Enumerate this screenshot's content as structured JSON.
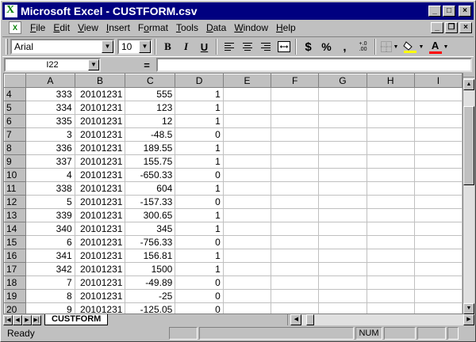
{
  "window": {
    "title": "Microsoft Excel - CUSTFORM.csv",
    "app_icon_glyph": "X",
    "minimize_glyph": "_",
    "maximize_glyph": "□",
    "close_glyph": "×"
  },
  "menu": {
    "items": [
      {
        "label": "File",
        "accel": "F",
        "rest": "ile"
      },
      {
        "label": "Edit",
        "accel": "E",
        "rest": "dit"
      },
      {
        "label": "View",
        "accel": "V",
        "rest": "iew"
      },
      {
        "label": "Insert",
        "accel": "I",
        "rest": "nsert"
      },
      {
        "label": "Format",
        "accel": "o",
        "pre": "F",
        "rest": "rmat"
      },
      {
        "label": "Tools",
        "accel": "T",
        "rest": "ools"
      },
      {
        "label": "Data",
        "accel": "D",
        "rest": "ata"
      },
      {
        "label": "Window",
        "accel": "W",
        "rest": "indow"
      },
      {
        "label": "Help",
        "accel": "H",
        "rest": "elp"
      }
    ],
    "doc_minimize_glyph": "_",
    "doc_restore_glyph": "❐",
    "doc_close_glyph": "×"
  },
  "toolbar": {
    "font_name": "Arial",
    "font_size": "10",
    "bold": "B",
    "italic": "I",
    "underline": "U",
    "currency": "$",
    "percent": "%",
    "comma": ",",
    "increase_decimal": "+.0\n.00",
    "font_color_letter": "A",
    "accent_red": "#ff0000",
    "accent_yellow": "#ffff00"
  },
  "formula_bar": {
    "name_box": "I22",
    "equals": "=",
    "formula": ""
  },
  "grid": {
    "columns": [
      "A",
      "B",
      "C",
      "D",
      "E",
      "F",
      "G",
      "H",
      "I"
    ],
    "rows": [
      {
        "n": "4",
        "a": "333",
        "b": "20101231",
        "c": "555",
        "d": "1"
      },
      {
        "n": "5",
        "a": "334",
        "b": "20101231",
        "c": "123",
        "d": "1"
      },
      {
        "n": "6",
        "a": "335",
        "b": "20101231",
        "c": "12",
        "d": "1"
      },
      {
        "n": "7",
        "a": "3",
        "b": "20101231",
        "c": "-48.5",
        "d": "0"
      },
      {
        "n": "8",
        "a": "336",
        "b": "20101231",
        "c": "189.55",
        "d": "1"
      },
      {
        "n": "9",
        "a": "337",
        "b": "20101231",
        "c": "155.75",
        "d": "1"
      },
      {
        "n": "10",
        "a": "4",
        "b": "20101231",
        "c": "-650.33",
        "d": "0"
      },
      {
        "n": "11",
        "a": "338",
        "b": "20101231",
        "c": "604",
        "d": "1"
      },
      {
        "n": "12",
        "a": "5",
        "b": "20101231",
        "c": "-157.33",
        "d": "0"
      },
      {
        "n": "13",
        "a": "339",
        "b": "20101231",
        "c": "300.65",
        "d": "1"
      },
      {
        "n": "14",
        "a": "340",
        "b": "20101231",
        "c": "345",
        "d": "1"
      },
      {
        "n": "15",
        "a": "6",
        "b": "20101231",
        "c": "-756.33",
        "d": "0"
      },
      {
        "n": "16",
        "a": "341",
        "b": "20101231",
        "c": "156.81",
        "d": "1"
      },
      {
        "n": "17",
        "a": "342",
        "b": "20101231",
        "c": "1500",
        "d": "1"
      },
      {
        "n": "18",
        "a": "7",
        "b": "20101231",
        "c": "-49.89",
        "d": "0"
      },
      {
        "n": "19",
        "a": "8",
        "b": "20101231",
        "c": "-25",
        "d": "0"
      },
      {
        "n": "20",
        "a": "9",
        "b": "20101231",
        "c": "-125.05",
        "d": "0"
      }
    ]
  },
  "sheet_tabs": {
    "active": "CUSTFORM"
  },
  "status_bar": {
    "text": "Ready",
    "num": "NUM"
  },
  "colors": {
    "title_bar": "#000080",
    "chrome": "#c0c0c0"
  }
}
